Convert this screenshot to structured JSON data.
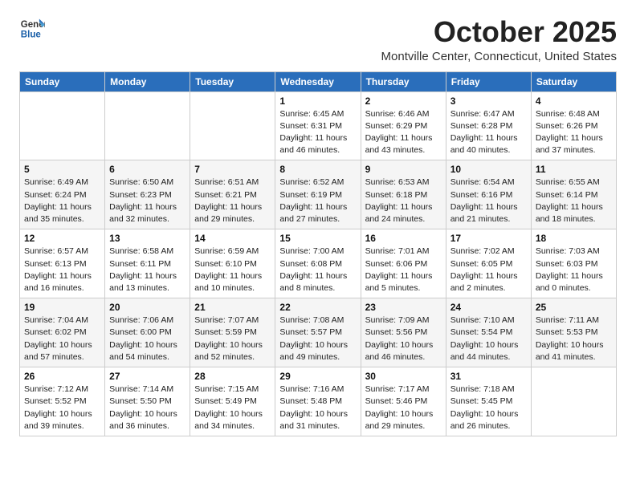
{
  "logo": {
    "general": "General",
    "blue": "Blue"
  },
  "title": "October 2025",
  "subtitle": "Montville Center, Connecticut, United States",
  "days_of_week": [
    "Sunday",
    "Monday",
    "Tuesday",
    "Wednesday",
    "Thursday",
    "Friday",
    "Saturday"
  ],
  "weeks": [
    [
      {
        "day": "",
        "info": ""
      },
      {
        "day": "",
        "info": ""
      },
      {
        "day": "",
        "info": ""
      },
      {
        "day": "1",
        "info": "Sunrise: 6:45 AM\nSunset: 6:31 PM\nDaylight: 11 hours\nand 46 minutes."
      },
      {
        "day": "2",
        "info": "Sunrise: 6:46 AM\nSunset: 6:29 PM\nDaylight: 11 hours\nand 43 minutes."
      },
      {
        "day": "3",
        "info": "Sunrise: 6:47 AM\nSunset: 6:28 PM\nDaylight: 11 hours\nand 40 minutes."
      },
      {
        "day": "4",
        "info": "Sunrise: 6:48 AM\nSunset: 6:26 PM\nDaylight: 11 hours\nand 37 minutes."
      }
    ],
    [
      {
        "day": "5",
        "info": "Sunrise: 6:49 AM\nSunset: 6:24 PM\nDaylight: 11 hours\nand 35 minutes."
      },
      {
        "day": "6",
        "info": "Sunrise: 6:50 AM\nSunset: 6:23 PM\nDaylight: 11 hours\nand 32 minutes."
      },
      {
        "day": "7",
        "info": "Sunrise: 6:51 AM\nSunset: 6:21 PM\nDaylight: 11 hours\nand 29 minutes."
      },
      {
        "day": "8",
        "info": "Sunrise: 6:52 AM\nSunset: 6:19 PM\nDaylight: 11 hours\nand 27 minutes."
      },
      {
        "day": "9",
        "info": "Sunrise: 6:53 AM\nSunset: 6:18 PM\nDaylight: 11 hours\nand 24 minutes."
      },
      {
        "day": "10",
        "info": "Sunrise: 6:54 AM\nSunset: 6:16 PM\nDaylight: 11 hours\nand 21 minutes."
      },
      {
        "day": "11",
        "info": "Sunrise: 6:55 AM\nSunset: 6:14 PM\nDaylight: 11 hours\nand 18 minutes."
      }
    ],
    [
      {
        "day": "12",
        "info": "Sunrise: 6:57 AM\nSunset: 6:13 PM\nDaylight: 11 hours\nand 16 minutes."
      },
      {
        "day": "13",
        "info": "Sunrise: 6:58 AM\nSunset: 6:11 PM\nDaylight: 11 hours\nand 13 minutes."
      },
      {
        "day": "14",
        "info": "Sunrise: 6:59 AM\nSunset: 6:10 PM\nDaylight: 11 hours\nand 10 minutes."
      },
      {
        "day": "15",
        "info": "Sunrise: 7:00 AM\nSunset: 6:08 PM\nDaylight: 11 hours\nand 8 minutes."
      },
      {
        "day": "16",
        "info": "Sunrise: 7:01 AM\nSunset: 6:06 PM\nDaylight: 11 hours\nand 5 minutes."
      },
      {
        "day": "17",
        "info": "Sunrise: 7:02 AM\nSunset: 6:05 PM\nDaylight: 11 hours\nand 2 minutes."
      },
      {
        "day": "18",
        "info": "Sunrise: 7:03 AM\nSunset: 6:03 PM\nDaylight: 11 hours\nand 0 minutes."
      }
    ],
    [
      {
        "day": "19",
        "info": "Sunrise: 7:04 AM\nSunset: 6:02 PM\nDaylight: 10 hours\nand 57 minutes."
      },
      {
        "day": "20",
        "info": "Sunrise: 7:06 AM\nSunset: 6:00 PM\nDaylight: 10 hours\nand 54 minutes."
      },
      {
        "day": "21",
        "info": "Sunrise: 7:07 AM\nSunset: 5:59 PM\nDaylight: 10 hours\nand 52 minutes."
      },
      {
        "day": "22",
        "info": "Sunrise: 7:08 AM\nSunset: 5:57 PM\nDaylight: 10 hours\nand 49 minutes."
      },
      {
        "day": "23",
        "info": "Sunrise: 7:09 AM\nSunset: 5:56 PM\nDaylight: 10 hours\nand 46 minutes."
      },
      {
        "day": "24",
        "info": "Sunrise: 7:10 AM\nSunset: 5:54 PM\nDaylight: 10 hours\nand 44 minutes."
      },
      {
        "day": "25",
        "info": "Sunrise: 7:11 AM\nSunset: 5:53 PM\nDaylight: 10 hours\nand 41 minutes."
      }
    ],
    [
      {
        "day": "26",
        "info": "Sunrise: 7:12 AM\nSunset: 5:52 PM\nDaylight: 10 hours\nand 39 minutes."
      },
      {
        "day": "27",
        "info": "Sunrise: 7:14 AM\nSunset: 5:50 PM\nDaylight: 10 hours\nand 36 minutes."
      },
      {
        "day": "28",
        "info": "Sunrise: 7:15 AM\nSunset: 5:49 PM\nDaylight: 10 hours\nand 34 minutes."
      },
      {
        "day": "29",
        "info": "Sunrise: 7:16 AM\nSunset: 5:48 PM\nDaylight: 10 hours\nand 31 minutes."
      },
      {
        "day": "30",
        "info": "Sunrise: 7:17 AM\nSunset: 5:46 PM\nDaylight: 10 hours\nand 29 minutes."
      },
      {
        "day": "31",
        "info": "Sunrise: 7:18 AM\nSunset: 5:45 PM\nDaylight: 10 hours\nand 26 minutes."
      },
      {
        "day": "",
        "info": ""
      }
    ]
  ]
}
